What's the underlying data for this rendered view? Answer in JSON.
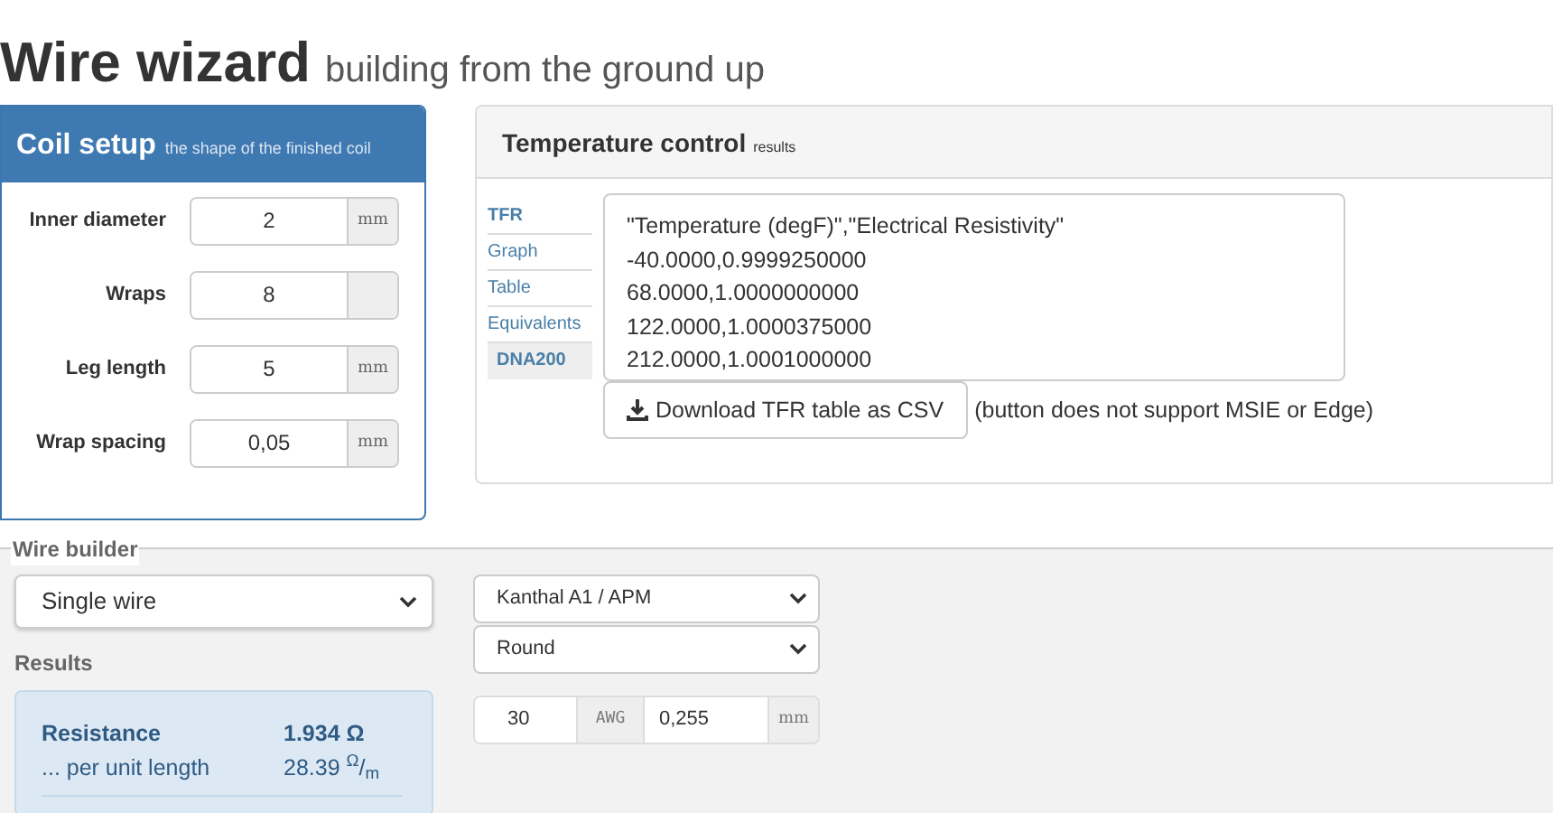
{
  "header": {
    "title": "Wire wizard",
    "subtitle": "building from the ground up"
  },
  "coil_setup": {
    "title": "Coil setup",
    "subtitle": "the shape of the finished coil",
    "fields": [
      {
        "label": "Inner diameter",
        "value": "2",
        "unit": "mm"
      },
      {
        "label": "Wraps",
        "value": "8"
      },
      {
        "label": "Leg length",
        "value": "5",
        "unit": "mm"
      },
      {
        "label": "Wrap spacing",
        "value": "0,05",
        "unit": "mm"
      }
    ]
  },
  "temperature_control": {
    "title": "Temperature control",
    "subtitle": "results",
    "tabs": [
      {
        "label": "TFR",
        "selected": false,
        "kind": "header"
      },
      {
        "label": "Graph",
        "selected": false,
        "kind": "link"
      },
      {
        "label": "Table",
        "selected": false,
        "kind": "link"
      },
      {
        "label": "Equivalents",
        "selected": false,
        "kind": "link"
      },
      {
        "label": "DNA200",
        "selected": true,
        "kind": "link"
      }
    ],
    "csv_lines": [
      "\"Temperature (degF)\",\"Electrical Resistivity\"",
      "-40.0000,0.9999250000",
      "68.0000,1.0000000000",
      "122.0000,1.0000375000",
      "212.0000,1.0001000000"
    ],
    "download_button": "Download TFR table as CSV",
    "note": "(button does not support MSIE or Edge)"
  },
  "wire_builder": {
    "legend": "Wire builder",
    "type_select": "Single wire",
    "material_select": "Kanthal A1 / APM",
    "profile_select": "Round",
    "gauge": {
      "value": "30",
      "unit": "AWG",
      "diameter": "0,255",
      "diameter_unit": "mm"
    },
    "results_title": "Results",
    "results": [
      {
        "label": "Resistance",
        "value": "1.934 Ω",
        "emphasis": true
      },
      {
        "label": "... per unit length",
        "value": "28.39 $^{Ω}$/$_{m}$",
        "emphasis": false
      }
    ]
  }
}
